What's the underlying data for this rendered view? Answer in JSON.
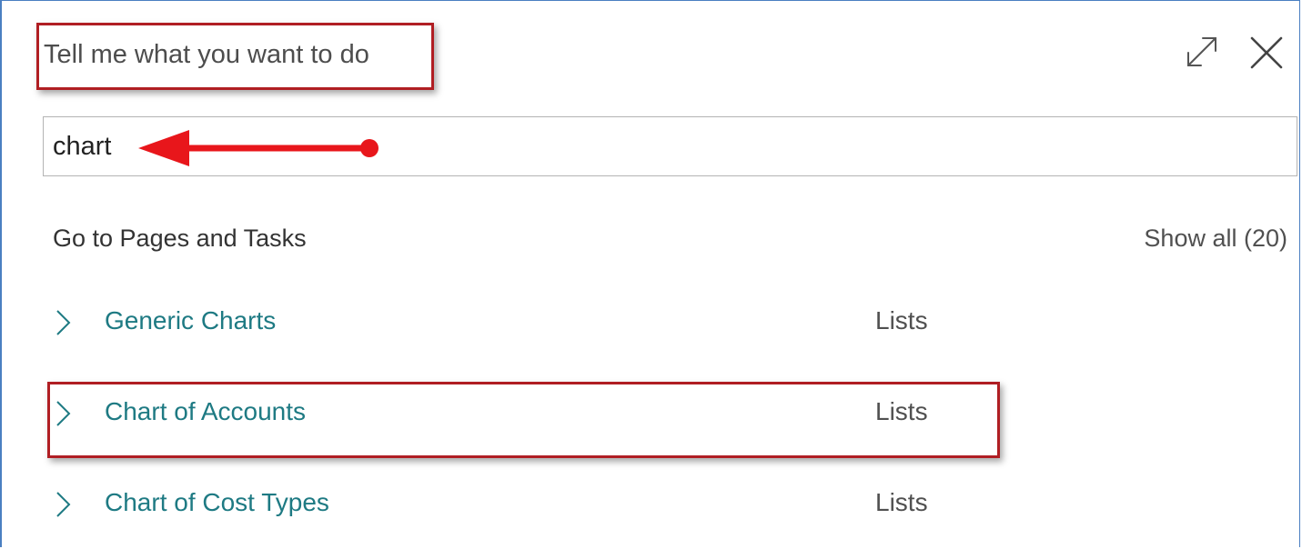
{
  "header": {
    "title": "Tell me what you want to do",
    "expand_icon": "expand-icon",
    "close_icon": "close-icon"
  },
  "search": {
    "value": "chart",
    "placeholder": ""
  },
  "results": {
    "section_title": "Go to Pages and Tasks",
    "show_all": "Show all (20)",
    "items": [
      {
        "label": "Generic Charts",
        "category": "Lists"
      },
      {
        "label": "Chart of Accounts",
        "category": "Lists"
      },
      {
        "label": "Chart of Cost Types",
        "category": "Lists"
      }
    ]
  },
  "colors": {
    "highlight": "#b01e23",
    "arrow": "#e8161b",
    "link": "#1e7a83",
    "frame": "#4a7fc1"
  }
}
